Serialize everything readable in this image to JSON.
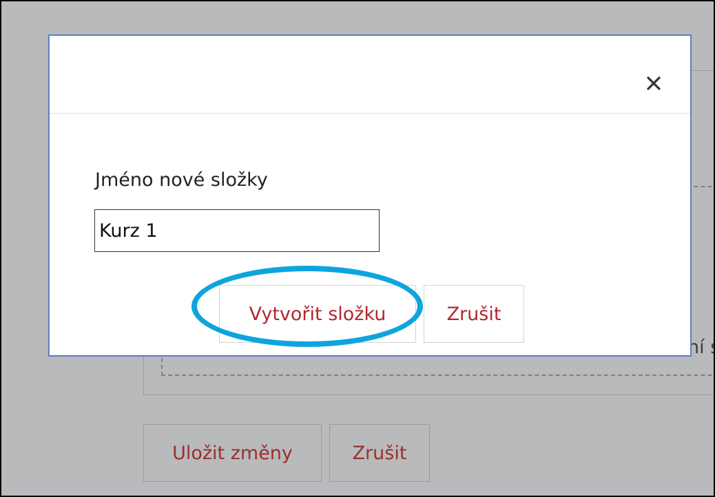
{
  "background": {
    "partial_text": "ní s",
    "save_button": "Uložit změny",
    "cancel_button": "Zrušit"
  },
  "dialog": {
    "close_icon": "close-icon",
    "close_glyph": "×",
    "field_label": "Jméno nové složky",
    "folder_name_value": "Kurz 1",
    "create_button": "Vytvořit složku",
    "cancel_button": "Zrušit"
  },
  "colors": {
    "accent_red": "#b3272d",
    "modal_border": "#5b7fbe",
    "highlight": "#0ea4dd"
  }
}
